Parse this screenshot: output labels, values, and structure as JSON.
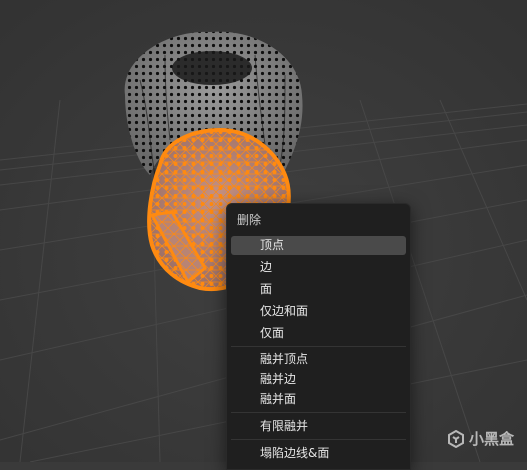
{
  "context_menu": {
    "title": "删除",
    "items": [
      {
        "label": "顶点",
        "active": true
      },
      {
        "label": "边"
      },
      {
        "label": "面"
      },
      {
        "label": "仅边和面"
      },
      {
        "label": "仅面"
      },
      {
        "label": "融并顶点"
      },
      {
        "label": "融并边"
      },
      {
        "label": "融并面"
      },
      {
        "label": "有限融并"
      },
      {
        "label": "塌陷边线&面"
      }
    ]
  },
  "watermark": {
    "text": "小黑盒"
  },
  "colors": {
    "viewport_bg": "#3a3a3a",
    "selected_orange": "#ff8a10",
    "menu_bg": "#1f1f1f",
    "highlight": "#4a4a4a"
  }
}
